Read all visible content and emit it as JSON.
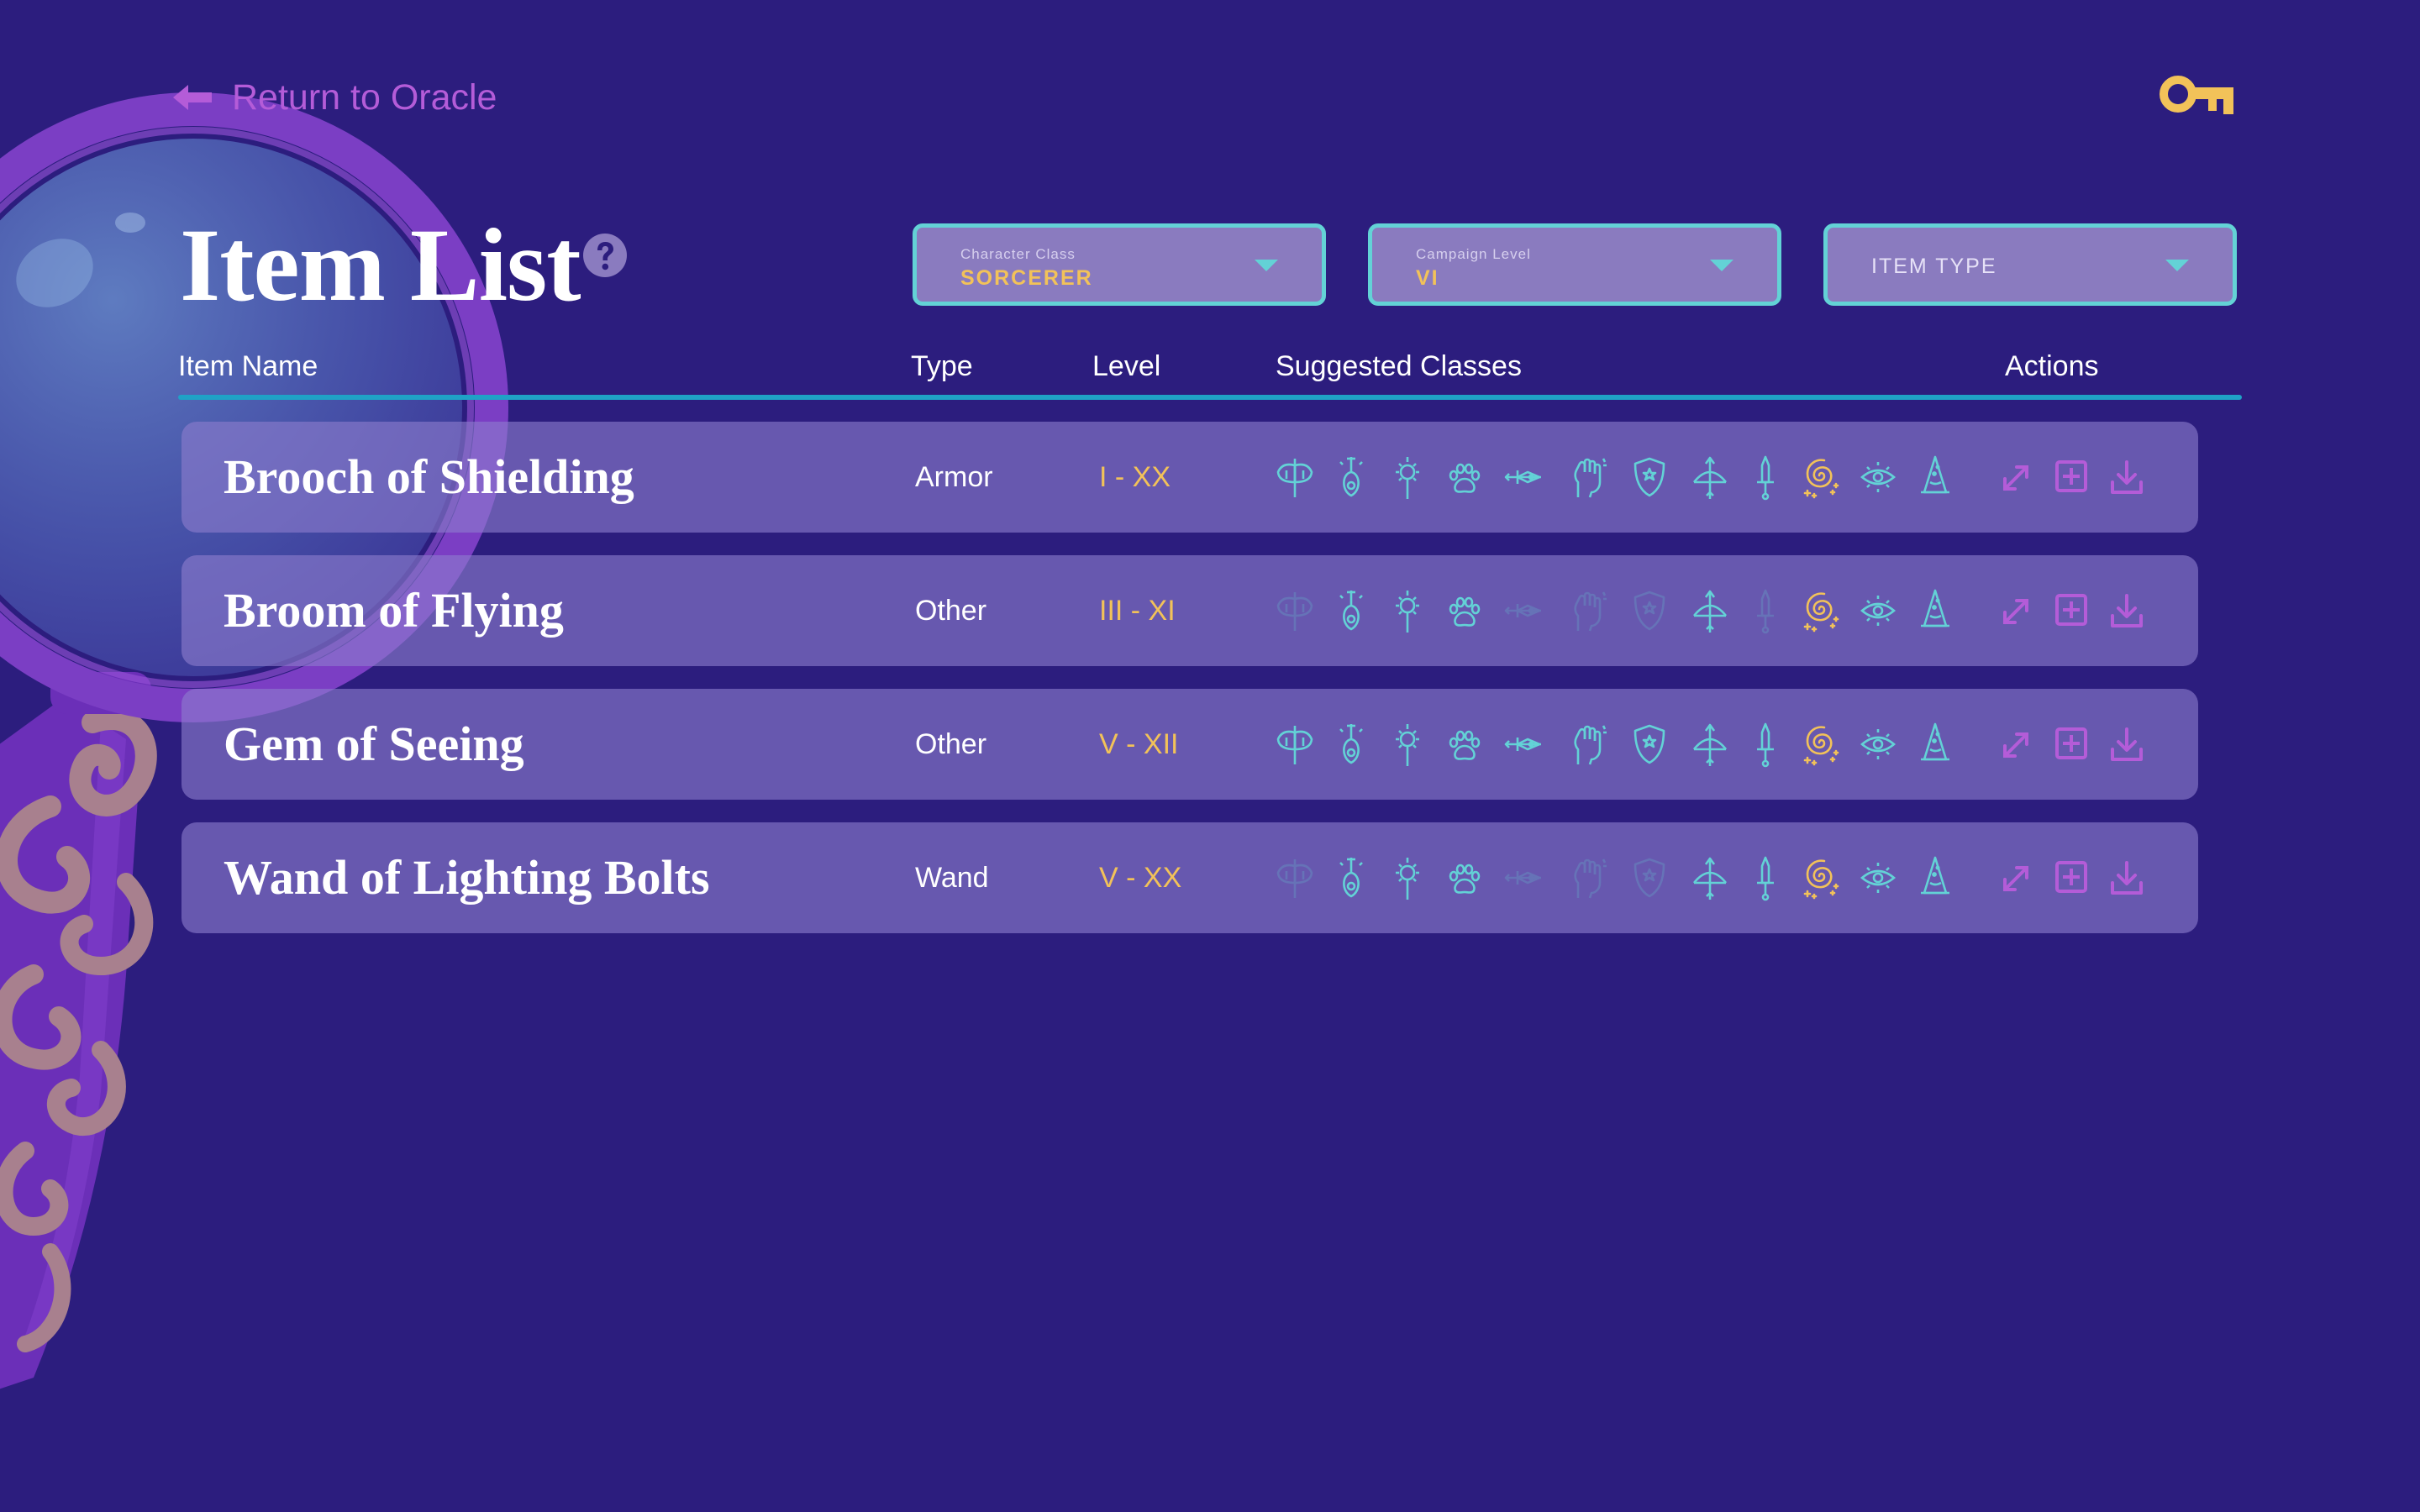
{
  "header": {
    "back_label": "Return to Oracle",
    "title": "Item List"
  },
  "filters": [
    {
      "label": "Character Class",
      "value": "SORCERER"
    },
    {
      "label": "Campaign Level",
      "value": "VI"
    },
    {
      "label": "",
      "placeholder": "ITEM TYPE"
    }
  ],
  "columns": {
    "name": "Item Name",
    "type": "Type",
    "level": "Level",
    "classes": "Suggested Classes",
    "actions": "Actions"
  },
  "class_icons": [
    "barbarian-axe-icon",
    "bard-lute-icon",
    "cleric-sun-icon",
    "druid-paw-icon",
    "fighter-sword-icon",
    "monk-fist-icon",
    "paladin-shield-icon",
    "ranger-bow-icon",
    "rogue-dagger-icon",
    "sorcerer-swirl-icon",
    "warlock-eye-icon",
    "wizard-hat-icon"
  ],
  "items": [
    {
      "name": "Brooch of Shielding",
      "type": "Armor",
      "level": "I - XX",
      "classes_active": [
        true,
        true,
        true,
        true,
        true,
        true,
        true,
        true,
        true,
        true,
        true,
        true
      ]
    },
    {
      "name": "Broom of Flying",
      "type": "Other",
      "level": "III - XI",
      "classes_active": [
        false,
        true,
        true,
        true,
        false,
        false,
        false,
        true,
        false,
        true,
        true,
        true
      ]
    },
    {
      "name": "Gem of Seeing",
      "type": "Other",
      "level": "V - XII",
      "classes_active": [
        true,
        true,
        true,
        true,
        true,
        true,
        true,
        true,
        true,
        true,
        true,
        true
      ]
    },
    {
      "name": "Wand of Lighting Bolts",
      "type": "Wand",
      "level": "V - XX",
      "classes_active": [
        false,
        true,
        true,
        true,
        false,
        false,
        false,
        true,
        true,
        true,
        true,
        true
      ]
    }
  ],
  "actions": [
    "expand-icon",
    "add-icon",
    "download-icon"
  ],
  "colors": {
    "background": "#2c1d7e",
    "accent_teal": "#63d2d6",
    "accent_gold": "#f2c259",
    "accent_purple": "#b45cd8",
    "row_bg": "#6a5aac"
  }
}
